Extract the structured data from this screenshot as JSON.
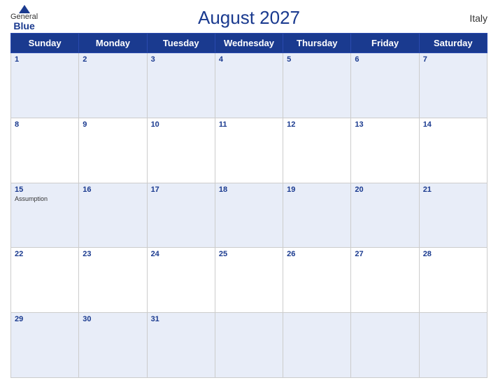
{
  "header": {
    "logo": {
      "general": "General",
      "blue": "Blue"
    },
    "title": "August 2027",
    "country": "Italy"
  },
  "weekdays": [
    "Sunday",
    "Monday",
    "Tuesday",
    "Wednesday",
    "Thursday",
    "Friday",
    "Saturday"
  ],
  "weeks": [
    [
      {
        "day": 1,
        "events": []
      },
      {
        "day": 2,
        "events": []
      },
      {
        "day": 3,
        "events": []
      },
      {
        "day": 4,
        "events": []
      },
      {
        "day": 5,
        "events": []
      },
      {
        "day": 6,
        "events": []
      },
      {
        "day": 7,
        "events": []
      }
    ],
    [
      {
        "day": 8,
        "events": []
      },
      {
        "day": 9,
        "events": []
      },
      {
        "day": 10,
        "events": []
      },
      {
        "day": 11,
        "events": []
      },
      {
        "day": 12,
        "events": []
      },
      {
        "day": 13,
        "events": []
      },
      {
        "day": 14,
        "events": []
      }
    ],
    [
      {
        "day": 15,
        "events": [
          "Assumption"
        ]
      },
      {
        "day": 16,
        "events": []
      },
      {
        "day": 17,
        "events": []
      },
      {
        "day": 18,
        "events": []
      },
      {
        "day": 19,
        "events": []
      },
      {
        "day": 20,
        "events": []
      },
      {
        "day": 21,
        "events": []
      }
    ],
    [
      {
        "day": 22,
        "events": []
      },
      {
        "day": 23,
        "events": []
      },
      {
        "day": 24,
        "events": []
      },
      {
        "day": 25,
        "events": []
      },
      {
        "day": 26,
        "events": []
      },
      {
        "day": 27,
        "events": []
      },
      {
        "day": 28,
        "events": []
      }
    ],
    [
      {
        "day": 29,
        "events": []
      },
      {
        "day": 30,
        "events": []
      },
      {
        "day": 31,
        "events": []
      },
      {
        "day": null,
        "events": []
      },
      {
        "day": null,
        "events": []
      },
      {
        "day": null,
        "events": []
      },
      {
        "day": null,
        "events": []
      }
    ]
  ]
}
